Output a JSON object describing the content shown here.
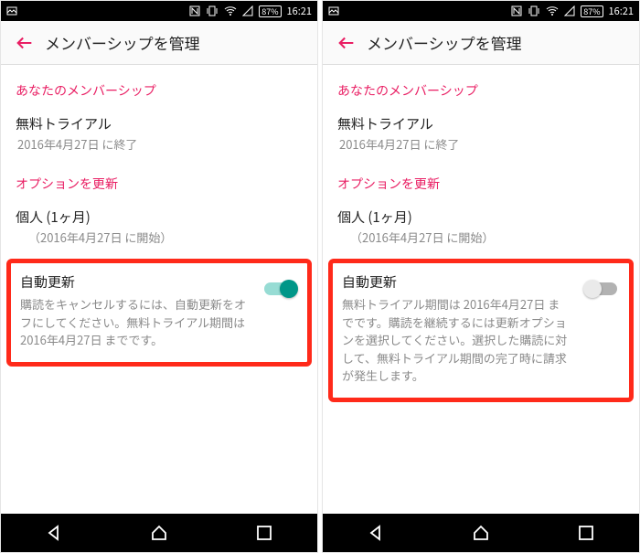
{
  "status": {
    "battery": "87%",
    "time": "16:21"
  },
  "appbar": {
    "title": "メンバーシップを管理"
  },
  "sections": {
    "membership_header": "あなたのメンバーシップ",
    "trial_title": "無料トライアル",
    "trial_sub": "2016年4月27日 に終了",
    "options_header": "オプションを更新",
    "plan_title": "個人 (1ヶ月)",
    "plan_sub": "（2016年4月27日 に開始）"
  },
  "left": {
    "auto_title": "自動更新",
    "auto_desc": "購読をキャンセルするには、自動更新をオフにしてください。無料トライアル期間は 2016年4月27日 までです。"
  },
  "right": {
    "auto_title": "自動更新",
    "auto_desc": "無料トライアル期間は 2016年4月27日 までです。購読を継続するには更新オプションを選択してください。選択した購読に対して、無料トライアル期間の完了時に請求が発生します。"
  }
}
